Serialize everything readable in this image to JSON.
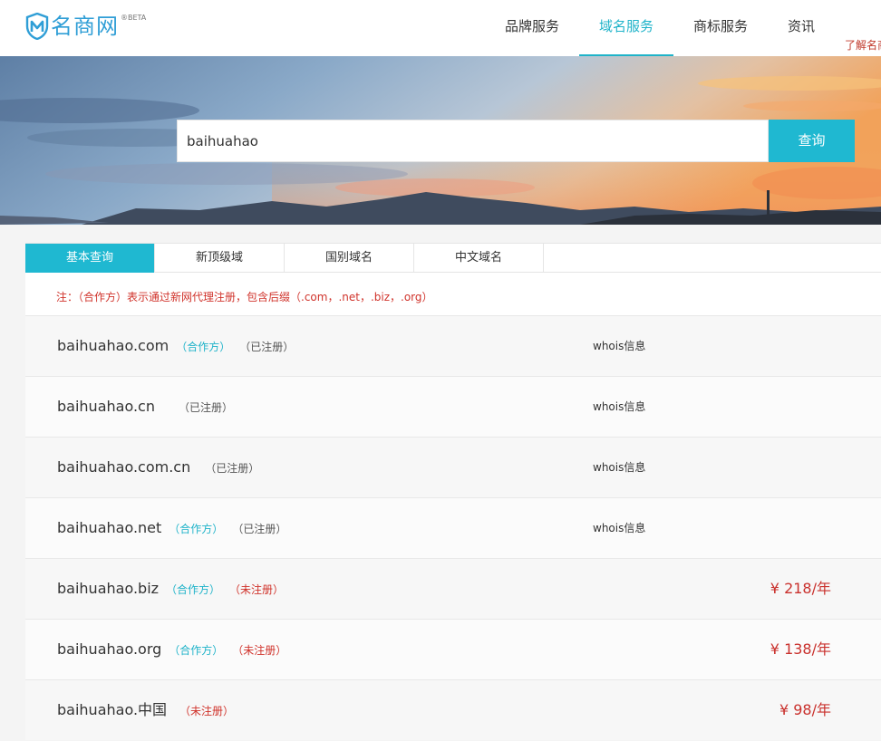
{
  "header": {
    "logo_text": "名商网",
    "logo_badge": "®BETA",
    "nav": [
      {
        "label": "品牌服务",
        "active": false
      },
      {
        "label": "域名服务",
        "active": true
      },
      {
        "label": "商标服务",
        "active": false
      },
      {
        "label": "资讯",
        "active": false
      }
    ],
    "learn_more": "了解名商"
  },
  "search": {
    "value": "baihuahao",
    "button": "查询"
  },
  "tabs": [
    {
      "label": "基本查询",
      "active": true
    },
    {
      "label": "新顶级域",
      "active": false
    },
    {
      "label": "国别域名",
      "active": false
    },
    {
      "label": "中文域名",
      "active": false
    }
  ],
  "note": "注：（合作方）表示通过新网代理注册，包含后缀（.com，.net，.biz，.org）",
  "results": [
    {
      "domain": "baihuahao.com",
      "partner": "（合作方）",
      "status": "（已注册）",
      "registered": true,
      "whois": "whois信息",
      "price": ""
    },
    {
      "domain": "baihuahao.cn",
      "partner": "",
      "status": "（已注册）",
      "registered": true,
      "whois": "whois信息",
      "price": ""
    },
    {
      "domain": "baihuahao.com.cn",
      "partner": "",
      "status": "（已注册）",
      "registered": true,
      "whois": "whois信息",
      "price": ""
    },
    {
      "domain": "baihuahao.net",
      "partner": "（合作方）",
      "status": "（已注册）",
      "registered": true,
      "whois": "whois信息",
      "price": ""
    },
    {
      "domain": "baihuahao.biz",
      "partner": "（合作方）",
      "status": "（未注册）",
      "registered": false,
      "whois": "",
      "price": "¥ 218/年"
    },
    {
      "domain": "baihuahao.org",
      "partner": "（合作方）",
      "status": "（未注册）",
      "registered": false,
      "whois": "",
      "price": "¥ 138/年"
    },
    {
      "domain": "baihuahao.中国",
      "partner": "",
      "status": "（未注册）",
      "registered": false,
      "whois": "",
      "price": "¥ 98/年"
    }
  ],
  "colors": {
    "accent": "#1fb8d1",
    "alert": "#d0332b",
    "logo": "#2f9ed6"
  }
}
